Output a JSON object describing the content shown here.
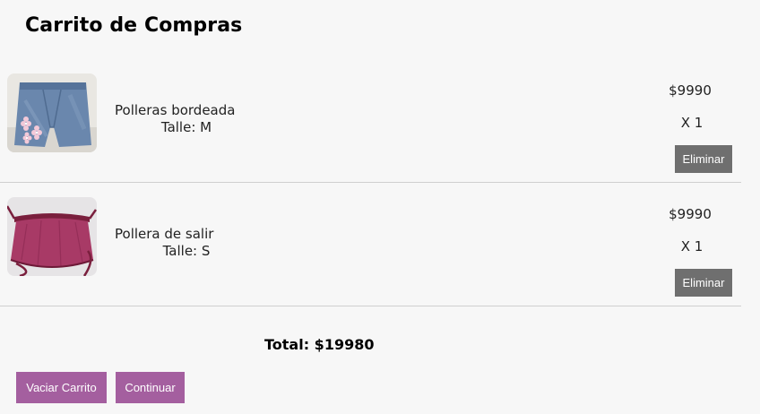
{
  "page": {
    "title": "Carrito de Compras"
  },
  "cart": {
    "items": [
      {
        "name": "Polleras bordeada",
        "size": "Talle: M",
        "price": "$9990",
        "quantity": "X 1",
        "remove_label": "Eliminar",
        "image": "denim-skort-with-flowers"
      },
      {
        "name": "Pollera de salir",
        "size": "Talle: S",
        "price": "$9990",
        "quantity": "X 1",
        "remove_label": "Eliminar",
        "image": "magenta-wrap-skirt"
      }
    ],
    "total": "Total: $19980"
  },
  "actions": {
    "clear_label": "Vaciar Carrito",
    "continue_label": "Continuar"
  },
  "colors": {
    "background": "#f7f7f7",
    "remove_button": "#6f6f6f",
    "primary_button": "#a45f9f"
  }
}
